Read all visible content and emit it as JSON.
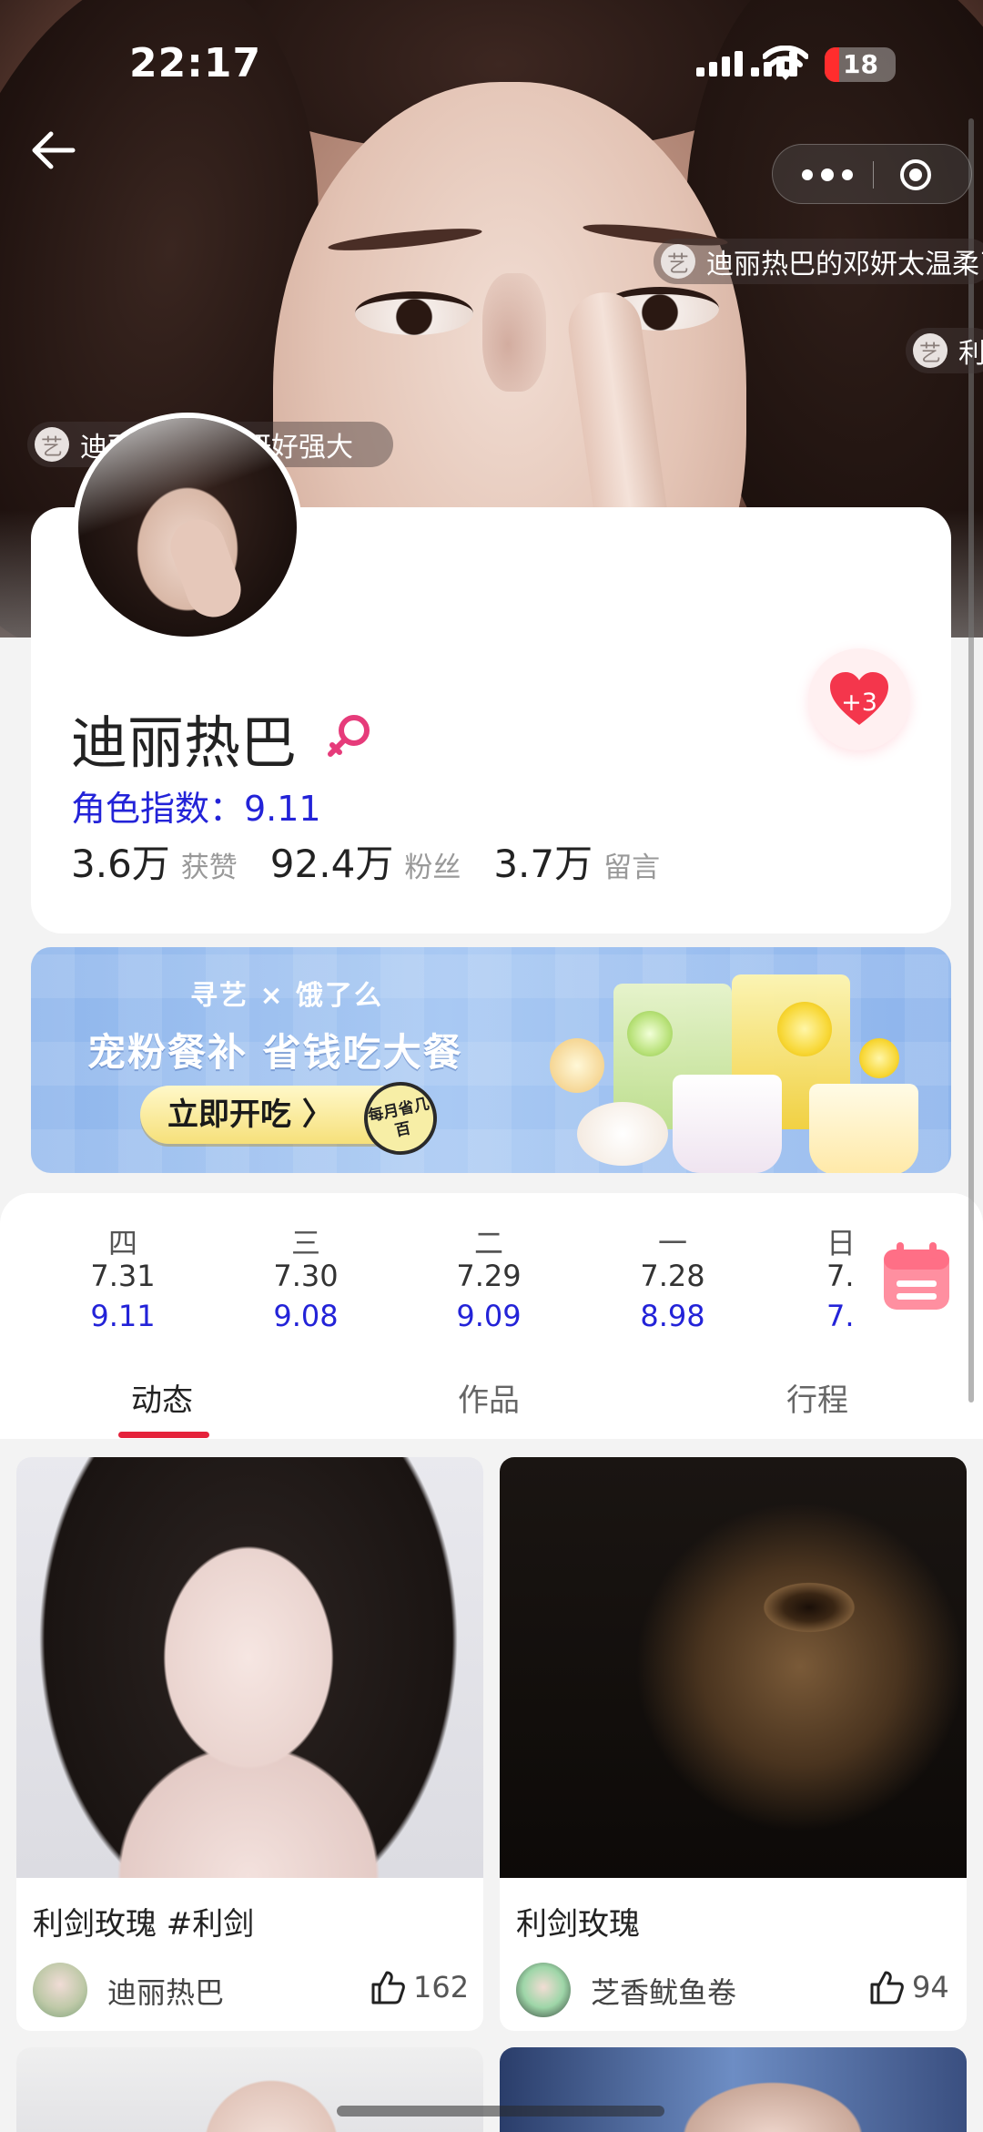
{
  "status_bar": {
    "time": "22:17",
    "battery": "18"
  },
  "danmaku": [
    {
      "icon": "艺",
      "text": "迪丽热巴的邓妍太温柔了"
    },
    {
      "icon": "艺",
      "text": "利"
    },
    {
      "icon": "艺",
      "text": "迪丽热巴的邓妍好强大"
    }
  ],
  "profile": {
    "name": "迪丽热巴",
    "index_label": "角色指数：9.11",
    "stats": [
      {
        "value": "3.6万",
        "label": "获赞"
      },
      {
        "value": "92.4万",
        "label": "粉丝"
      },
      {
        "value": "3.7万",
        "label": "留言"
      }
    ],
    "like_badge": "+3"
  },
  "banner": {
    "brand": "寻艺 × 饿了么",
    "slogan": "宠粉餐补 省钱吃大餐",
    "cta": "立即开吃 〉",
    "stamp": "每月省几百"
  },
  "days": [
    {
      "weekday": "四",
      "date": "7.31",
      "score": "9.11"
    },
    {
      "weekday": "三",
      "date": "7.30",
      "score": "9.08"
    },
    {
      "weekday": "二",
      "date": "7.29",
      "score": "9.09"
    },
    {
      "weekday": "一",
      "date": "7.28",
      "score": "8.98"
    },
    {
      "weekday": "日",
      "date": "7.",
      "score": "7."
    }
  ],
  "tabs": [
    {
      "label": "动态"
    },
    {
      "label": "作品"
    },
    {
      "label": "行程"
    }
  ],
  "feed": [
    {
      "title": "利剑玫瑰 #利剑",
      "author": "迪丽热巴",
      "likes": "162"
    },
    {
      "title": "利剑玫瑰",
      "author": "芝香鱿鱼卷",
      "likes": "94"
    }
  ],
  "colors": {
    "accent_red": "#e5223b",
    "index_blue": "#2323d8",
    "female_pink": "#e63b7a"
  }
}
